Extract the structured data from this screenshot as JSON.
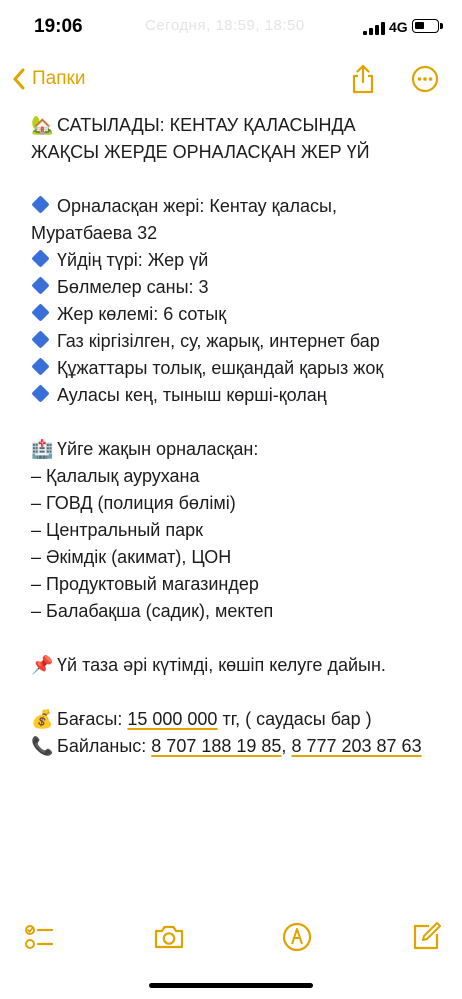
{
  "status_bar": {
    "time": "19:06",
    "network": "4G",
    "ghost_text": "Сегодня, 18:59, 18:50"
  },
  "nav": {
    "back_label": "Папки"
  },
  "note": {
    "title_line1": "САТЫЛАДЫ: КЕНТАУ ҚАЛАСЫНДА",
    "title_line2": "ЖАҚСЫ ЖЕРДЕ ОРНАЛАСҚАН ЖЕР ҮЙ",
    "details": [
      "Орналасқан жері: Кентау қаласы, Муратбаева 32",
      "Үйдің түрі: Жер үй",
      "Бөлмелер саны: 3",
      "Жер көлемі: 6 сотық",
      "Газ кіргізілген, су, жарық, интернет бар",
      "Құжаттары толық, ешқандай қарыз жоқ",
      "Ауласы кең, тыныш көрші-қолаң"
    ],
    "nearby_heading": "Үйге жақын орналасқан:",
    "nearby": [
      "– Қалалық аурухана",
      "– ГОВД (полиция бөлімі)",
      "– Центральный парк",
      "– Әкімдік (акимат), ЦОН",
      "– Продуктовый магазиндер",
      "– Балабақша (садик), мектеп"
    ],
    "condition": "Үй таза әрі күтімді, көшіп келуге дайын.",
    "price_label": "Бағасы:",
    "price_value": "15 000 000",
    "price_suffix": "тг, ( саудасы бар )",
    "contact_label": "Байланыс:",
    "phone1": "8 707 188 19 85",
    "separator": ",",
    "phone2": "8 777 203 87 63"
  },
  "icons": {
    "title": "house-with-garden-icon",
    "bullet": "blue-diamond-icon",
    "nearby": "hospital-icon",
    "condition": "pushpin-icon",
    "price": "money-bag-icon",
    "contact": "telephone-icon"
  },
  "colors": {
    "accent": "#e0a300",
    "bullet": "#3b6fd8",
    "text": "#1c1c1e"
  }
}
